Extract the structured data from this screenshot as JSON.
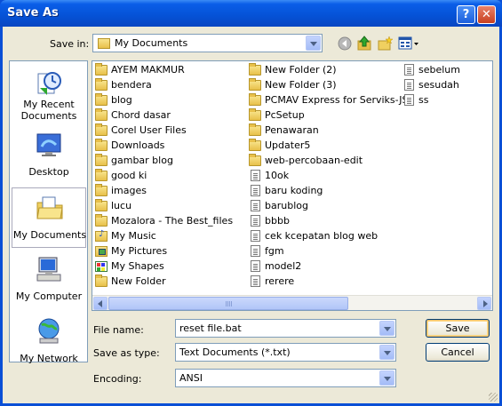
{
  "window": {
    "title": "Save As"
  },
  "save_in": {
    "label": "Save in:",
    "value": "My Documents"
  },
  "places": [
    {
      "label": "My Recent Documents",
      "icon": "recent-documents-icon"
    },
    {
      "label": "Desktop",
      "icon": "desktop-icon"
    },
    {
      "label": "My Documents",
      "icon": "my-documents-icon",
      "selected": true
    },
    {
      "label": "My Computer",
      "icon": "my-computer-icon"
    },
    {
      "label": "My Network",
      "icon": "my-network-icon"
    }
  ],
  "files": {
    "col1": [
      {
        "name": "AYEM MAKMUR",
        "type": "folder"
      },
      {
        "name": "bendera",
        "type": "folder"
      },
      {
        "name": "blog",
        "type": "folder"
      },
      {
        "name": "Chord dasar",
        "type": "folder"
      },
      {
        "name": "Corel User Files",
        "type": "folder"
      },
      {
        "name": "Downloads",
        "type": "folder"
      },
      {
        "name": "gambar blog",
        "type": "folder"
      },
      {
        "name": "good ki",
        "type": "folder"
      },
      {
        "name": "images",
        "type": "folder"
      },
      {
        "name": "lucu",
        "type": "folder"
      },
      {
        "name": "Mozalora - The Best_files",
        "type": "folder"
      },
      {
        "name": "My Music",
        "type": "music"
      },
      {
        "name": "My Pictures",
        "type": "pictures"
      },
      {
        "name": "My Shapes",
        "type": "shapes"
      },
      {
        "name": "New Folder",
        "type": "folder"
      }
    ],
    "col2": [
      {
        "name": "New Folder (2)",
        "type": "folder"
      },
      {
        "name": "New Folder (3)",
        "type": "folder"
      },
      {
        "name": "PCMAV Express for Serviks-JS",
        "type": "folder"
      },
      {
        "name": "PcSetup",
        "type": "folder"
      },
      {
        "name": "Penawaran",
        "type": "folder"
      },
      {
        "name": "Updater5",
        "type": "folder"
      },
      {
        "name": "web-percobaan-edit",
        "type": "folder"
      },
      {
        "name": "10ok",
        "type": "file"
      },
      {
        "name": "baru koding",
        "type": "file"
      },
      {
        "name": "barublog",
        "type": "file"
      },
      {
        "name": "bbbb",
        "type": "file"
      },
      {
        "name": "cek kcepatan blog web",
        "type": "file"
      },
      {
        "name": "fgm",
        "type": "file"
      },
      {
        "name": "model2",
        "type": "file"
      },
      {
        "name": "rerere",
        "type": "file"
      }
    ],
    "col3": [
      {
        "name": "sebelum",
        "type": "file"
      },
      {
        "name": "sesudah",
        "type": "file"
      },
      {
        "name": "ss",
        "type": "file"
      }
    ]
  },
  "file_name": {
    "label": "File name:",
    "value": "reset file.bat"
  },
  "save_as_type": {
    "label": "Save as type:",
    "value": "Text Documents (*.txt)"
  },
  "encoding": {
    "label": "Encoding:",
    "value": "ANSI"
  },
  "buttons": {
    "save": "Save",
    "cancel": "Cancel",
    "help": "?",
    "close": "✕"
  }
}
